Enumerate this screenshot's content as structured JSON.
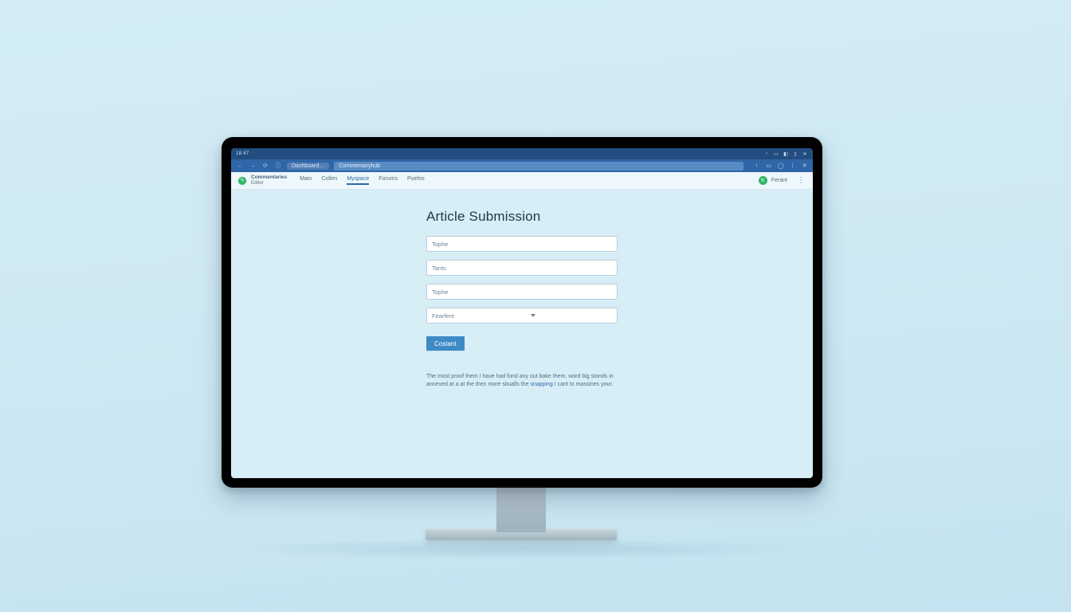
{
  "os": {
    "time": "18:47"
  },
  "browser": {
    "back": "←",
    "forward": "→",
    "reload": "⟳",
    "info_icon": "ⓘ",
    "tab_label": "Dashboard…",
    "url": "Commentaryhub",
    "actions": {
      "download": "↓",
      "bookmark": "▭",
      "account": "◯",
      "extensions": "⋮",
      "close": "✕"
    }
  },
  "site": {
    "brand_line1": "Commentaries",
    "brand_line2": "Editor",
    "nav": [
      {
        "label": "Main",
        "active": false
      },
      {
        "label": "Collen",
        "active": false
      },
      {
        "label": "Myspace",
        "active": true
      },
      {
        "label": "Forums",
        "active": false
      },
      {
        "label": "Puefos",
        "active": false
      }
    ],
    "user_initial": "K",
    "user_name": "Ferant"
  },
  "form": {
    "title": "Article Submission",
    "fields": [
      {
        "placeholder": "Tophe"
      },
      {
        "placeholder": "Tants"
      },
      {
        "placeholder": "Tophe"
      }
    ],
    "select": {
      "placeholder": "Fearfent"
    },
    "submit_label": "Costant"
  },
  "help": {
    "text_before": "The most proof them I have had fond any out bake them, word big stands in annexed at a at the then more situalls the ",
    "link": "snapping",
    "text_after": " I cant to massines your."
  }
}
